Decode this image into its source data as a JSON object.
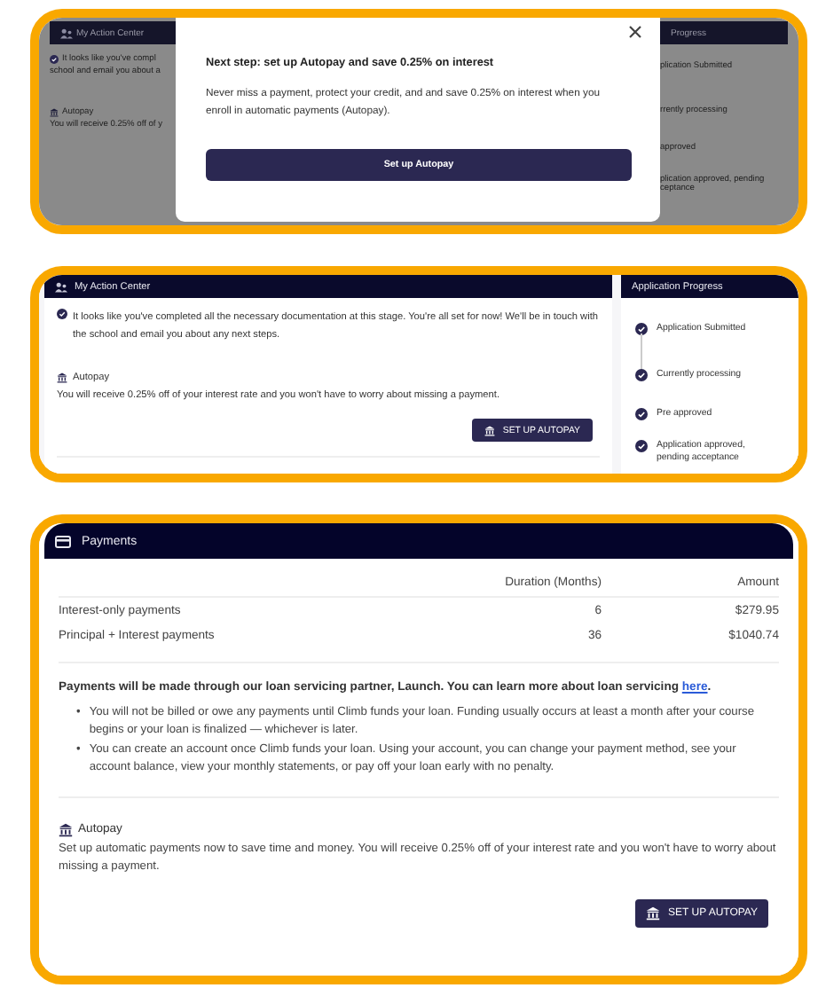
{
  "modal_view": {
    "background": {
      "left_title": "My Action Center",
      "right_title": "Progress",
      "status_lines": [
        "It looks like you've compl",
        "school and email you about a"
      ],
      "autopay_label": "Autopay",
      "autopay_text": "You will receive 0.25% off of y",
      "steps": [
        "plication Submitted",
        "rrently processing",
        "approved",
        "plication approved, pending",
        "ceptance"
      ]
    },
    "modal": {
      "title": "Next step: set up Autopay and save 0.25% on interest",
      "body": "Never miss a payment, protect your credit, and and save 0.25% on interest when you enroll in automatic payments (Autopay).",
      "button": "Set up Autopay"
    }
  },
  "action_center_view": {
    "title": "My Action Center",
    "status_text": "It looks like you've completed all the necessary documentation at this stage. You're all set for now! We'll be in touch with the school and email you about any next steps.",
    "autopay_label": "Autopay",
    "autopay_text": "You will receive 0.25% off of your interest rate and you won't have to worry about missing a payment.",
    "button": "SET UP AUTOPAY",
    "progress": {
      "title": "Application Progress",
      "steps": [
        {
          "label": "Application Submitted",
          "done": true
        },
        {
          "label": "Currently processing",
          "done": true
        },
        {
          "label": "Pre approved",
          "done": true
        },
        {
          "label": "Application approved, pending acceptance",
          "done": true
        }
      ]
    }
  },
  "payments_view": {
    "title": "Payments",
    "columns": [
      "Duration (Months)",
      "Amount"
    ],
    "rows": [
      {
        "name": "Interest-only payments",
        "duration": "6",
        "amount": "$279.95"
      },
      {
        "name": "Principal + Interest payments",
        "duration": "36",
        "amount": "$1040.74"
      }
    ],
    "note": "Payments will be made through our loan servicing partner, Launch. You can learn more about loan servicing",
    "note_link": "here",
    "note_end": ".",
    "bullets": [
      {
        "marker": "•",
        "text": "You will not be billed or owe any payments until Climb funds your loan. Funding usually occurs at least a month after your course begins or your loan is finalized — whichever is later."
      },
      {
        "marker": "•",
        "text": "You can create an account once Climb funds your loan. Using your account, you can change your payment method, see your account balance, view your monthly statements, or pay off your loan early with no penalty."
      }
    ],
    "autopay_label": "Autopay",
    "autopay_text": "Set up automatic payments now to save time and money. You will receive 0.25% off of your interest rate and you won't have to worry about missing a payment.",
    "button": "SET UP AUTOPAY"
  }
}
